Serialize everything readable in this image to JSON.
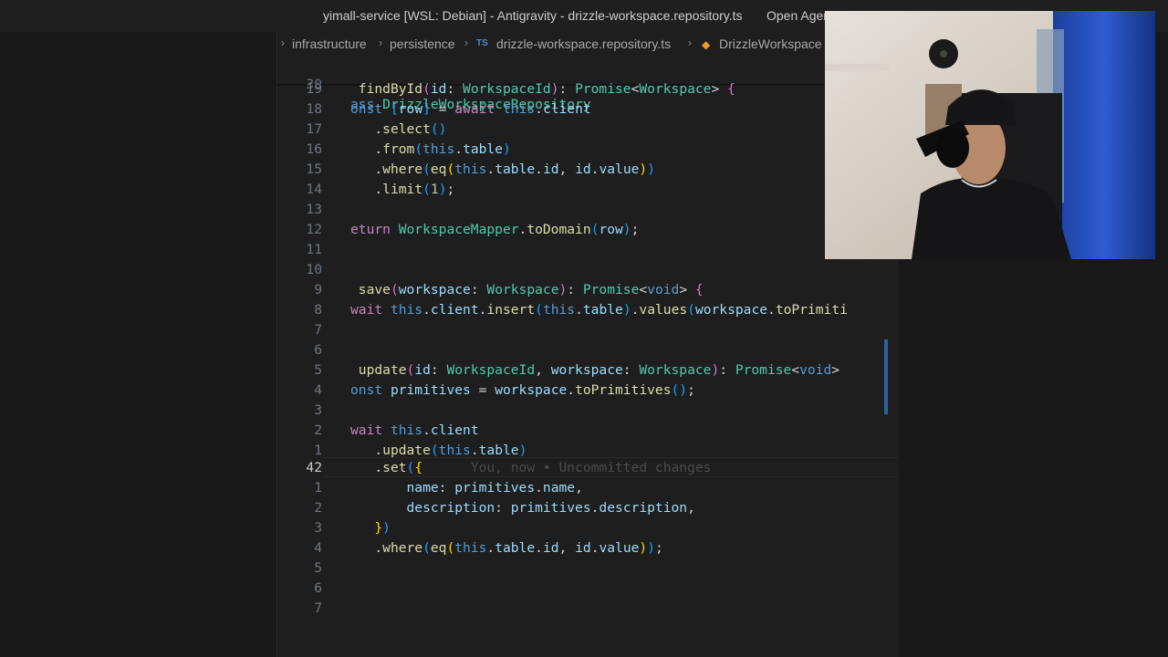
{
  "window": {
    "title": "yimall-service [WSL: Debian] - Antigravity - drizzle-workspace.repository.ts",
    "agent_manager_label": "Open Agent M..."
  },
  "breadcrumb": {
    "items": [
      "infrastructure",
      "persistence",
      "drizzle-workspace.repository.ts",
      "DrizzleWorkspace"
    ],
    "file_badge": "TS"
  },
  "editor": {
    "sticky_line_number": "30",
    "sticky_text": "ass DrizzleWorkspaceRepository",
    "current_line_number": "42",
    "inline_blame": "You, now • Uncommitted changes",
    "line_numbers": [
      "19",
      "18",
      "17",
      "16",
      "15",
      "14",
      "13",
      "12",
      "11",
      "10",
      "9",
      "8",
      "7",
      "6",
      "5",
      "4",
      "3",
      "2",
      "1",
      "42",
      "1",
      "2",
      "3",
      "4",
      "5",
      "6",
      "7"
    ]
  },
  "colors": {
    "background": "#1e1e1e",
    "keyword": "#569cd6",
    "control": "#c586c0",
    "function": "#dcdcaa",
    "type": "#4ec9b0",
    "variable": "#9cdcfe"
  },
  "icons": [
    "chevron-right-icon",
    "typescript-file-icon",
    "class-symbol-icon",
    "layout-icon"
  ]
}
